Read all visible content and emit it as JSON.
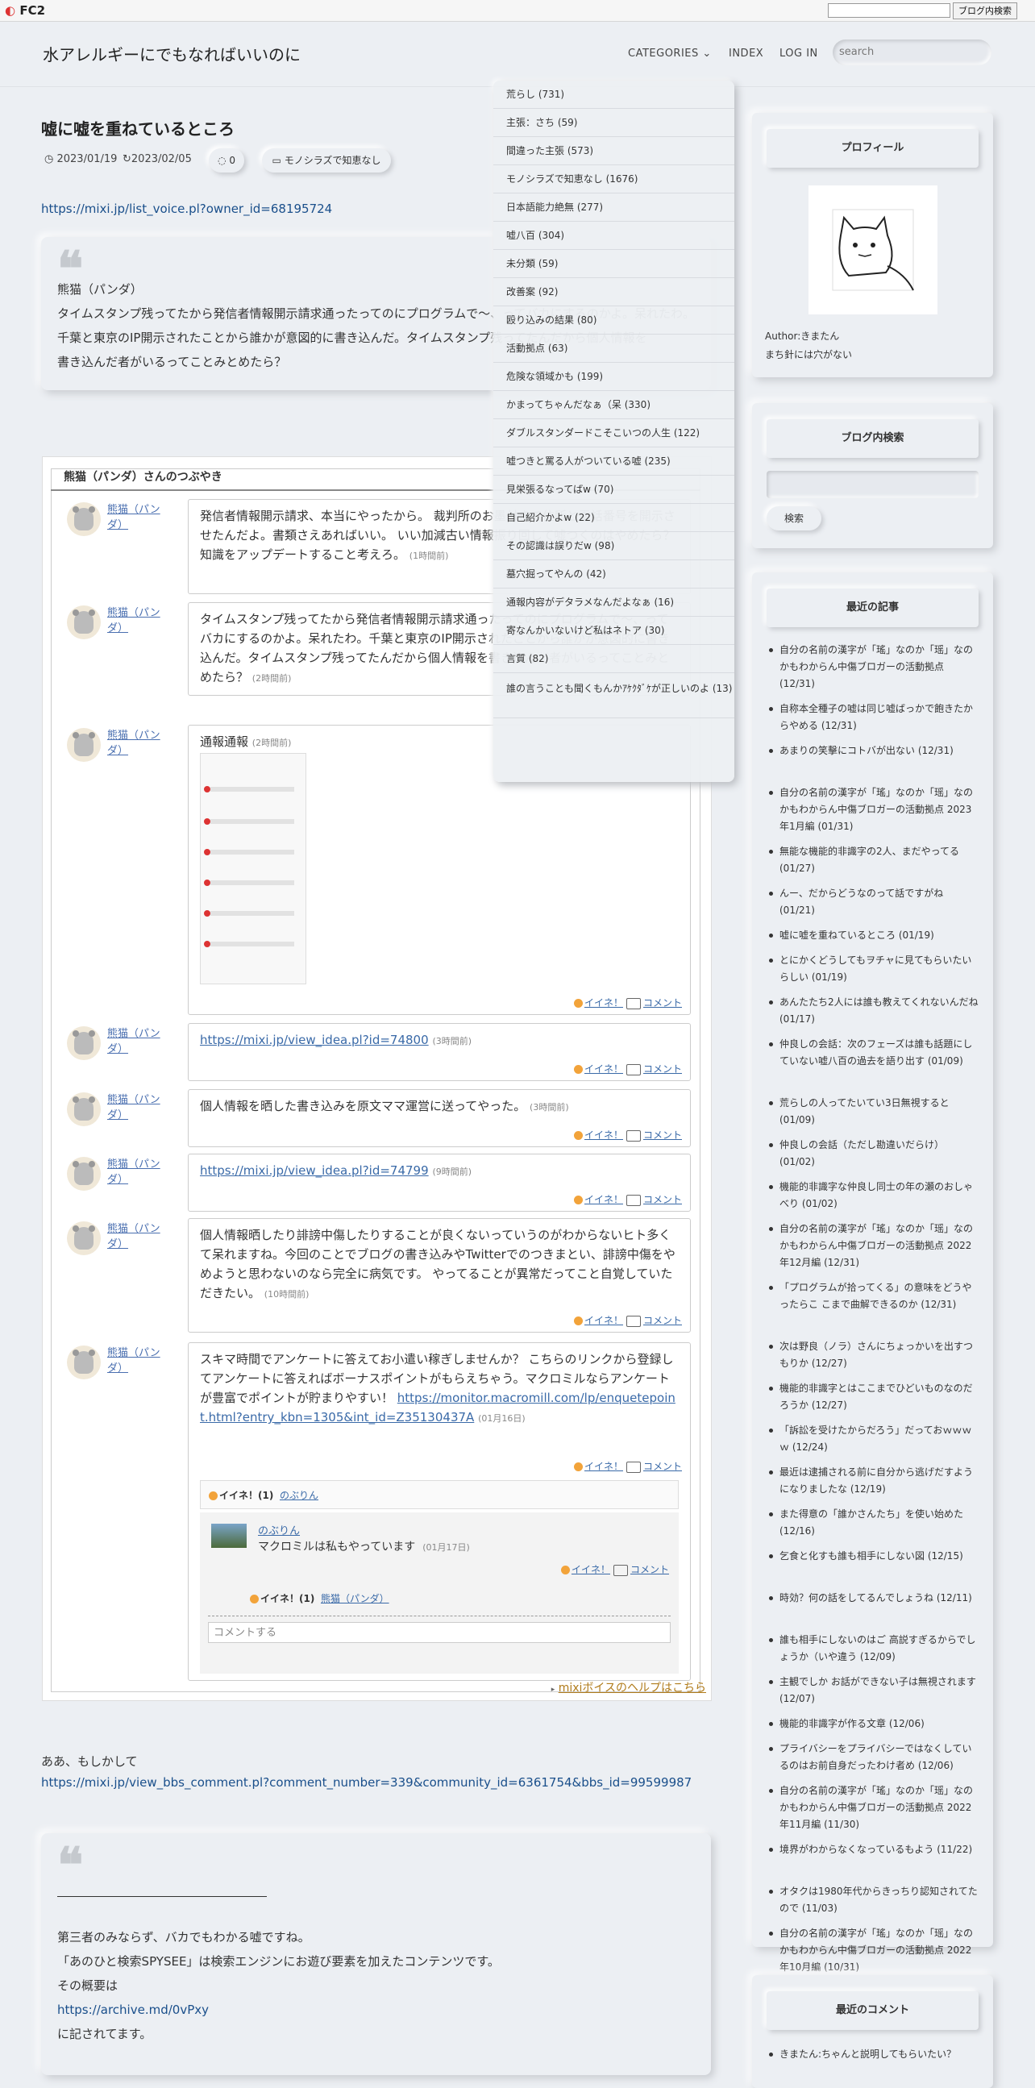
{
  "fc2": {
    "logo": "FC2",
    "search_button": "ブログ内検索"
  },
  "header": {
    "site_title": "水アレルギーにでもなればいいのに",
    "nav": {
      "categories": "CATEGORIES",
      "index": "INDEX",
      "login": "LOG IN"
    },
    "search_placeholder": "search"
  },
  "post": {
    "title": "嘘に嘘を重ねているところ",
    "date": "2023/01/19",
    "updated": "2023/02/05",
    "comments": "0",
    "category": "モノシラズで知恵なし",
    "link1": "https://mixi.jp/list_voice.pl?owner_id=68195724",
    "quote1_lines": [
      "熊猫（パンダ）",
      "タイムスタンプ残ってたから発信者情報開示請求通ったってのにプログラムで～、ってバカにするのかよ。呆れたわ。",
      "千葉と東京のIP開示されたことから誰かが意図的に書き込んだ。タイムスタンプ残ってたんだから個人情報を",
      "書き込んだ者がいるってことみとめたら？"
    ],
    "voice_header": "熊猫（パンダ）さんのつぶやき",
    "voice_footer": "mixiボイスのヘルプはこちら",
    "voice_rows": [
      {
        "name": "熊猫（パンダ）",
        "text": "発信者情報開示請求、本当にやったから。 裁判所のお墨付きで住所と電話番号を開示させたんだよ。書類さえあればいい。 いい加減古い情報振り回して嘘つくのはやめたら？ 知識をアップデートすること考えろ。",
        "when": "(1時間前)"
      },
      {
        "name": "熊猫（パンダ）",
        "text": "タイムスタンプ残ってたから発信者情報開示請求通ったってのにプログラムで～、ってバカにするのかよ。呆れたわ。千葉と東京のIP開示されたことから誰かが意図的に書き込んだ。タイムスタンプ残ってたんだから個人情報を書き込んだ者がいるってことみとめたら？",
        "when": "(2時間前)"
      },
      {
        "name": "熊猫（パンダ）",
        "text": "通報通報",
        "when": "(2時間前)"
      },
      {
        "name": "熊猫（パンダ）",
        "text": "https://mixi.jp/view_idea.pl?id=74800",
        "when": "(3時間前)"
      },
      {
        "name": "熊猫（パンダ）",
        "text": "個人情報を晒した書き込みを原文ママ運営に送ってやった。",
        "when": "(3時間前)"
      },
      {
        "name": "熊猫（パンダ）",
        "text": "https://mixi.jp/view_idea.pl?id=74799",
        "when": "(9時間前)"
      },
      {
        "name": "熊猫（パンダ）",
        "text": "個人情報晒したり誹謗中傷したりすることが良くないっていうのがわからないヒト多くて呆れますね。今回のことでブログの書き込みやTwitterでのつきまとい、誹謗中傷をやめようと思わないのなら完全に病気です。 やってることが異常だってこと自覚していただきたい。",
        "when": "(10時間前)"
      },
      {
        "name": "熊猫（パンダ）",
        "text": "スキマ時間でアンケートに答えてお小遣い稼ぎしませんか？ こちらのリンクから登録してアンケートに答えればボーナスポイントがもらえちゃう。マクロミルならアンケートが豊富でポイントが貯まりやすい！ ",
        "link": "https://monitor.macromill.com/lp/enquetepoint.html?entry_kbn=1305&int_id=Z35130437A",
        "when": "(01月16日)"
      }
    ],
    "actions": {
      "like": "イイネ！",
      "comment": "コメント"
    },
    "like_count": "イイネ！(1)",
    "liker1": "のぶりん",
    "reply_name": "のぶりん",
    "reply_text": "マクロミルは私もやっています",
    "reply_when": "(01月17日)",
    "liker2": "熊猫（パンダ）",
    "comment_placeholder": "コメントする",
    "para1": "ああ、もしかして",
    "link2": "https://mixi.jp/view_bbs_comment.pl?comment_number=339&community_id=6361754&bbs_id=99599987",
    "quote2_lines": [
      "第三者のみならず、バカでもわかる嘘ですね。",
      "「あのひと検索SPYSEE」は検索エンジンにお遊び要素を加えたコンテンツです。",
      "その概要は"
    ],
    "quote2_link": "https://archive.md/0vPxy",
    "quote2_tail": "に記されてます。"
  },
  "categories": [
    "荒らし (731)",
    "主張：さち (59)",
    "間違った主張 (573)",
    "モノシラズで知恵なし (1676)",
    "日本語能力絶無 (277)",
    "嘘八百 (304)",
    "未分類 (59)",
    "改善案 (92)",
    "殴り込みの結果 (80)",
    "活動拠点 (63)",
    "危険な領域かも (199)",
    "かまってちゃんだなぁ（呆 (330)",
    "ダブルスタンダードこそこいつの人生 (122)",
    "嘘つきと罵る人がついている嘘 (235)",
    "見栄張るなってばw (70)",
    "自己紹介かよw (22)",
    "その認識は誤りだw (98)",
    "墓穴掘ってやんの (42)",
    "通報内容がデタラメなんだよなぁ (16)",
    "寄なんかいないけど私はネトア (30)",
    "言質 (82)",
    "誰の言うことも聞くもんかｱｹｸﾀﾞｹが正しいのよ (13)"
  ],
  "sidebar": {
    "profile_title": "プロフィール",
    "author": "Author:きまたん",
    "author_tagline": "まち針には穴がない",
    "search_title": "ブログ内検索",
    "search_button": "検索",
    "recent_title": "最近の記事",
    "recent": [
      "自分の名前の漢字が「瑤」なのか「瑶」なのかもわからん中傷ブロガーの活動拠点 (12/31)",
      "自称本全種子の嘘は同じ嘘ばっかで飽きたからやめる (12/31)",
      "あまりの笑擊にコトバが出ない (12/31)",
      "自分の名前の漢字が「瑤」なのか「瑶」なのかもわからん中傷ブロガーの活動拠点 2023年1月編 (01/31)",
      "無能な機能的非識字の2人、まだやってる (01/27)",
      "んー、だからどうなのって話ですがね (01/21)",
      "嘘に嘘を重ねているところ (01/19)",
      "とにかくどうしてもヲチャに見てもらいたいらしい (01/19)",
      "あんたたち2人には誰も教えてくれないんだね (01/17)",
      "仲良しの会話：次のフェーズは誰も話題にしていない嘘八百の過去を語り出す (01/09)",
      "荒らしの人ってたいてい3日無視すると (01/09)",
      "仲良しの会話（ただし勘違いだらけ） (01/02)",
      "機能的非識字な仲良し同士の年の瀬のおしゃべり (01/02)",
      "自分の名前の漢字が「瑤」なのか「瑶」なのかもわからん中傷ブロガーの活動拠点 2022年12月編 (12/31)",
      "「プログラムが拾ってくる」の意味をどうやったらこ こまで曲解できるのか (12/31)",
      "次は野良（ノラ）さんにちょっかいを出すつもりか (12/27)",
      "機能的非識字とはここまでひどいものなのだろうか (12/27)",
      "「訴訟を受けたからだろう」だっておｗｗｗｗ (12/24)",
      "最近は逮捕される前に自分から逃げだすようになりましたな (12/19)",
      "また得意の「誰かさんたち」を使い始めた (12/16)",
      "乞食と化すも誰も相手にしない図 (12/15)",
      "時効？何の話をしてるんでしょうね (12/11)",
      "誰も相手にしないのはご 高説すぎるからでしょうか（いや違う (12/09)",
      "主観でしか お話ができない子は無視されます (12/07)",
      "機能的非識字が作る文章 (12/06)",
      "プライバシーをプライバシーではなくしているのはお前自身だったわけ者め (12/06)",
      "自分の名前の漢字が「瑤」なのか「瑶」なのかもわからん中傷ブロガーの活動拠点 2022年11月編 (11/30)",
      "境界がわからなくなっているもよう (11/22)",
      "オタクは1980年代からきっちり認知されてたので (11/03)",
      "自分の名前の漢字が「瑤」なのか「瑶」なのかもわからん中傷ブロガーの活動拠点 2022年10月編 (10/31)"
    ],
    "comments_title": "最近のコメント",
    "comments": [
      "きまたん:ちゃんと説明してもらいたい？"
    ]
  }
}
